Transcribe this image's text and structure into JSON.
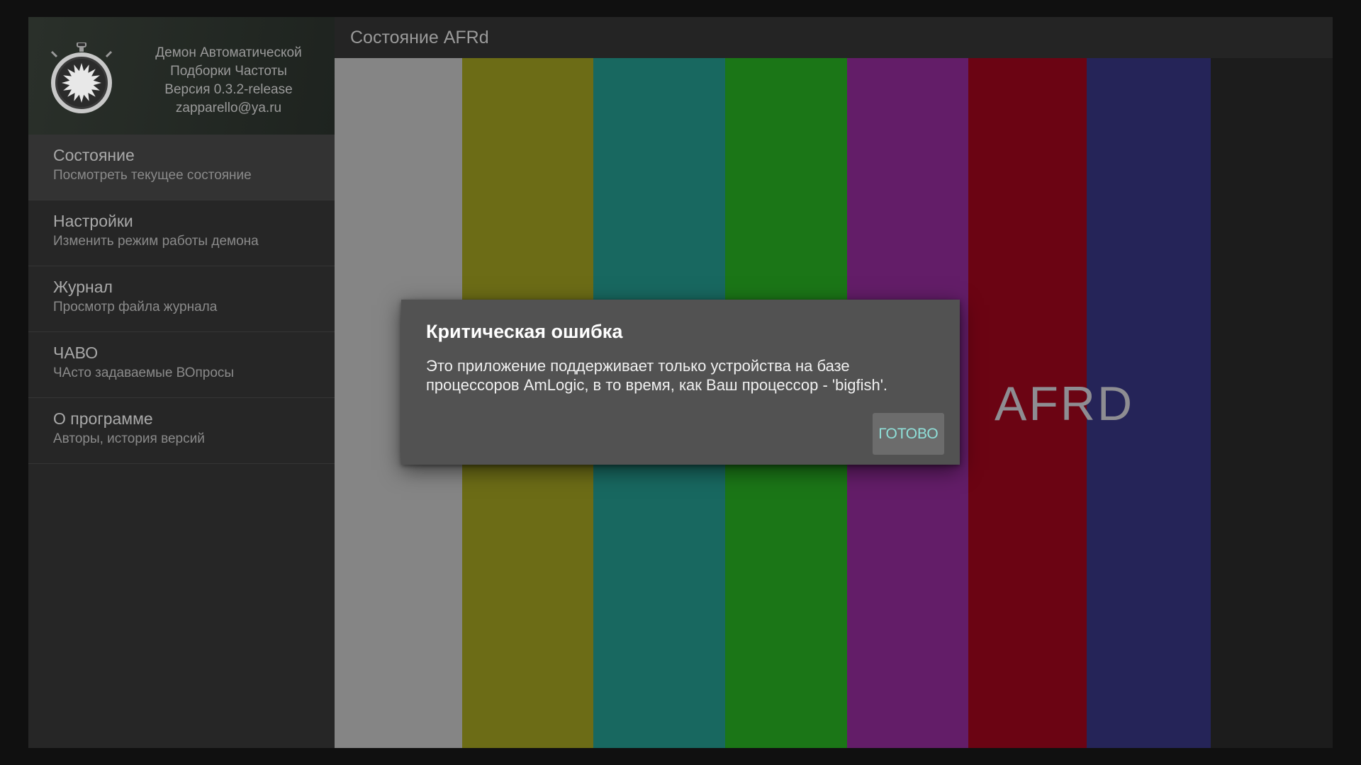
{
  "sidebar": {
    "header": {
      "line1": "Демон Автоматической",
      "line2": "Подборки Частоты",
      "version": "Версия 0.3.2-release",
      "email": "zapparello@ya.ru",
      "logo_icon": "stopwatch-icon"
    },
    "items": [
      {
        "title": "Состояние",
        "subtitle": "Посмотреть текущее состояние",
        "active": true
      },
      {
        "title": "Настройки",
        "subtitle": "Изменить режим работы демона",
        "active": false
      },
      {
        "title": "Журнал",
        "subtitle": "Просмотр файла журнала",
        "active": false
      },
      {
        "title": "ЧАВО",
        "subtitle": "ЧАсто задаваемые ВОпросы",
        "active": false
      },
      {
        "title": "О программе",
        "subtitle": "Авторы, история версий",
        "active": false
      }
    ]
  },
  "main": {
    "title": "Состояние AFRd",
    "background_label": "AFRD",
    "color_bars": [
      "#858585",
      "#6c6c16",
      "#186860",
      "#1b7617",
      "#631d68",
      "#6b0413",
      "#252458"
    ]
  },
  "dialog": {
    "title": "Критическая ошибка",
    "message_line1": "Это приложение поддерживает только устройства на базе",
    "message_line2": "процессоров AmLogic, в то время, как Ваш процессор - 'bigfish'.",
    "button": "ГОТОВО"
  }
}
